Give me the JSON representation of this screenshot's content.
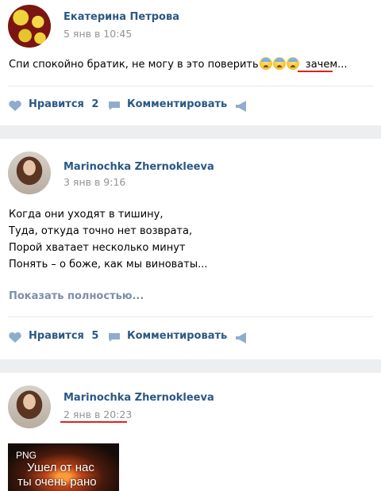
{
  "posts": [
    {
      "author": "Екатерина Петрова",
      "date": "5 янв в 10:45",
      "text_before": "Спи спокойно братик, не могу в это поверить",
      "emoji": [
        "anxious-face-emoji",
        "anxious-face-emoji",
        "anxious-face-emoji"
      ],
      "text_link": "зачем",
      "text_after": "...",
      "like_label": "Нравится",
      "like_count": "2",
      "comment_label": "Комментировать"
    },
    {
      "author": "Marinochka Zhernokleeva",
      "date": "3 янв в 9:16",
      "lines": [
        "Когда они уходят в тишину,",
        "Туда, откуда точно нет возврата,",
        "Порой хватает несколько минут",
        "Понять – о боже, как мы виноваты..."
      ],
      "show_more": "Показать полностью...",
      "like_label": "Нравится",
      "like_count": "5",
      "comment_label": "Комментировать"
    },
    {
      "author": "Marinochka Zhernokleeva",
      "date": "2 янв в 20:23",
      "attachment": {
        "badge": "PNG",
        "caption_line1": "Ушел от нас",
        "caption_line2": "ты очень рано"
      }
    }
  ],
  "colors": {
    "link": "#2a5885",
    "date": "#939393",
    "background": "#edeef0",
    "annotation_red": "#e02020"
  }
}
